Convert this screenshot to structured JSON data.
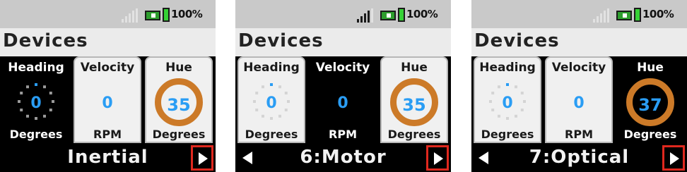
{
  "status": {
    "battery_percent": "100%",
    "signal_bars_active": [
      0,
      4,
      0
    ]
  },
  "screens": [
    {
      "title": "Devices",
      "widgets": {
        "heading": {
          "label": "Heading",
          "value": "0",
          "unit": "Degrees"
        },
        "velocity": {
          "label": "Velocity",
          "value": "0",
          "unit": "RPM"
        },
        "hue": {
          "label": "Hue",
          "value": "35",
          "unit": "Degrees"
        }
      },
      "active_widget": "heading",
      "footer": {
        "label": "Inertial",
        "has_prev": false,
        "has_next": true
      }
    },
    {
      "title": "Devices",
      "widgets": {
        "heading": {
          "label": "Heading",
          "value": "0",
          "unit": "Degrees"
        },
        "velocity": {
          "label": "Velocity",
          "value": "0",
          "unit": "RPM"
        },
        "hue": {
          "label": "Hue",
          "value": "35",
          "unit": "Degrees"
        }
      },
      "active_widget": "velocity",
      "footer": {
        "label": "6:Motor",
        "has_prev": true,
        "has_next": true
      }
    },
    {
      "title": "Devices",
      "widgets": {
        "heading": {
          "label": "Heading",
          "value": "0",
          "unit": "Degrees"
        },
        "velocity": {
          "label": "Velocity",
          "value": "0",
          "unit": "RPM"
        },
        "hue": {
          "label": "Hue",
          "value": "37",
          "unit": "Degrees"
        }
      },
      "active_widget": "hue",
      "footer": {
        "label": "7:Optical",
        "has_prev": true,
        "has_next": true
      }
    }
  ],
  "colors": {
    "value_blue": "#2a9df4",
    "hue_ring": "#cc7a28",
    "highlight_red": "#e0281e",
    "status_bg": "#c9c9c9",
    "title_bg": "#ebebeb"
  },
  "icons": [
    "signal-icon",
    "battery-icon",
    "prev-arrow-icon",
    "next-arrow-icon",
    "heading-dial-icon",
    "hue-ring-icon"
  ]
}
